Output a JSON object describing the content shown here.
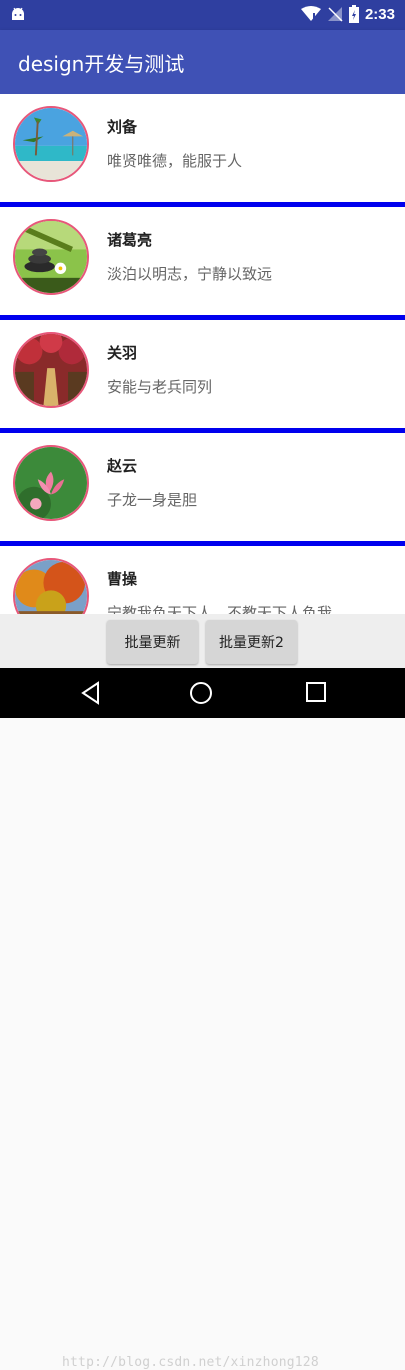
{
  "status_bar": {
    "time": "2:33"
  },
  "app_bar": {
    "title": "design开发与测试"
  },
  "list": [
    {
      "name": "刘备",
      "desc": "唯贤唯德，能服于人"
    },
    {
      "name": "诸葛亮",
      "desc": "淡泊以明志，宁静以致远"
    },
    {
      "name": "关羽",
      "desc": "安能与老兵同列"
    },
    {
      "name": "赵云",
      "desc": "子龙一身是胆"
    },
    {
      "name": "曹操",
      "desc": "宁教我负天下人，不教天下人负我"
    }
  ],
  "buttons": {
    "batch_update": "批量更新",
    "batch_update_2": "批量更新2"
  },
  "watermark": "http://blog.csdn.net/xinzhong128",
  "colors": {
    "status_bar": "#2f3fa0",
    "app_bar": "#3f51b5",
    "divider": "#0000ee",
    "avatar_border": "#e7577a"
  }
}
